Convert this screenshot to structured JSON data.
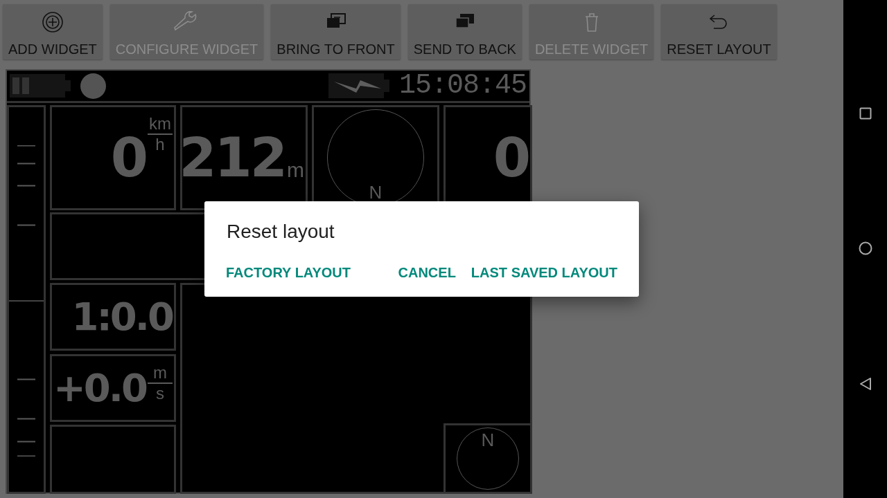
{
  "toolbar": {
    "buttons": [
      {
        "kind": "add",
        "label": "ADD WIDGET",
        "disabled": false
      },
      {
        "kind": "configure",
        "label": "CONFIGURE WIDGET",
        "disabled": true
      },
      {
        "kind": "front",
        "label": "BRING TO FRONT",
        "disabled": false
      },
      {
        "kind": "back",
        "label": "SEND TO BACK",
        "disabled": false
      },
      {
        "kind": "delete",
        "label": "DELETE WIDGET",
        "disabled": true
      },
      {
        "kind": "reset",
        "label": "RESET LAYOUT",
        "disabled": false
      }
    ]
  },
  "display": {
    "status_bar": {
      "time": "15:08:45"
    },
    "widgets": [
      {
        "kind": "vario_bar"
      },
      {
        "kind": "value",
        "value": "0",
        "unit_top": "km",
        "unit_bottom": "h"
      },
      {
        "kind": "value",
        "value": "212",
        "unit": "m"
      },
      {
        "kind": "compass",
        "heading_label": "N"
      },
      {
        "kind": "value",
        "value": "0"
      },
      {
        "kind": "empty"
      },
      {
        "kind": "value",
        "value": "1:0.0"
      },
      {
        "kind": "value",
        "value": "+0.0",
        "unit_top": "m",
        "unit_bottom": "s"
      },
      {
        "kind": "empty"
      },
      {
        "kind": "map"
      },
      {
        "kind": "compass",
        "heading_label": "N"
      }
    ]
  },
  "dialog": {
    "title": "Reset layout",
    "buttons": [
      "FACTORY LAYOUT",
      "CANCEL",
      "LAST SAVED LAYOUT"
    ]
  }
}
